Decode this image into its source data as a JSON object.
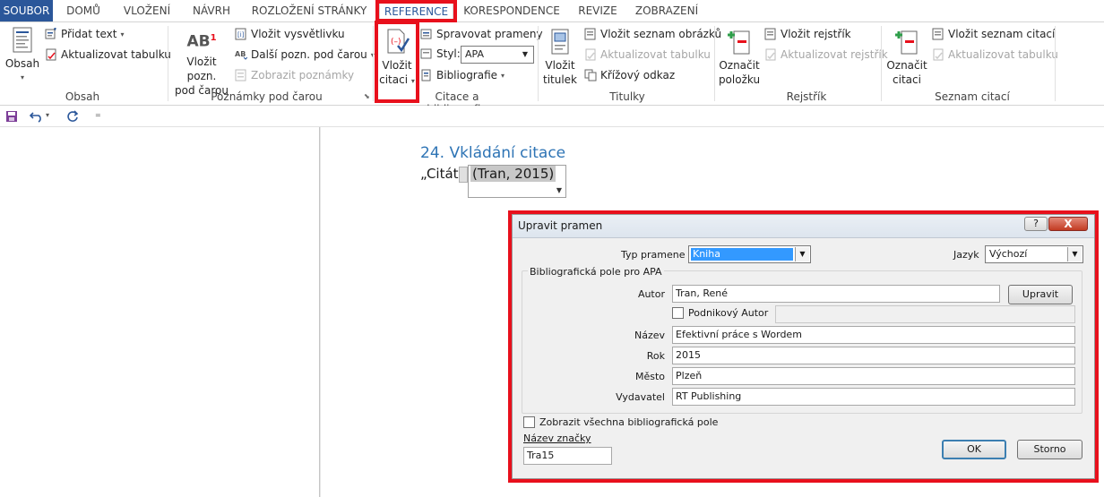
{
  "tabs": [
    {
      "label": "SOUBOR",
      "kind": "file"
    },
    {
      "label": "DOMŮ"
    },
    {
      "label": "VLOŽENÍ"
    },
    {
      "label": "NÁVRH"
    },
    {
      "label": "ROZLOŽENÍ STRÁNKY"
    },
    {
      "label": "REFERENCE",
      "kind": "active"
    },
    {
      "label": "KORESPONDENCE"
    },
    {
      "label": "REVIZE"
    },
    {
      "label": "ZOBRAZENÍ"
    }
  ],
  "ribbon": {
    "obsah": {
      "group_label": "Obsah",
      "big_label": "Obsah",
      "pridat_text": "Přidat text",
      "aktualizovat_tabulku": "Aktualizovat tabulku"
    },
    "poznamky": {
      "group_label": "Poznámky pod čarou",
      "big_label_1": "Vložit pozn.",
      "big_label_2": "pod čarou",
      "big_icon_text": "AB",
      "big_icon_sup": "1",
      "vlozit_vysvetlivku": "Vložit vysvětlivku",
      "dalsi_pozn": "Další pozn. pod čarou",
      "zobrazit_poznamky": "Zobrazit poznámky"
    },
    "citace": {
      "group_label": "Citace a bibliografie",
      "big_label_1": "Vložit",
      "big_label_2": "citaci",
      "spravovat_prameny": "Spravovat prameny",
      "styl_label": "Styl:",
      "styl_value": "APA",
      "bibliografie": "Bibliografie"
    },
    "titulky": {
      "group_label": "Titulky",
      "big_label_1": "Vložit",
      "big_label_2": "titulek",
      "vlozit_seznam_obrazku": "Vložit seznam obrázků",
      "aktualizovat_tabulku": "Aktualizovat tabulku",
      "krizovy_odkaz": "Křížový odkaz"
    },
    "rejstrik": {
      "group_label": "Rejstřík",
      "big_label_1": "Označit",
      "big_label_2": "položku",
      "vlozit_rejstrik": "Vložit rejstřík",
      "aktualizovat_rejstrik": "Aktualizovat rejstřík"
    },
    "seznam_citaci": {
      "group_label": "Seznam citací",
      "big_label_1": "Označit",
      "big_label_2": "citaci",
      "vlozit_seznam_citaci": "Vložit seznam citací",
      "aktualizovat_tabulku": "Aktualizovat tabulku"
    }
  },
  "document": {
    "heading": "24. Vkládání citace",
    "quote_prefix": "„Citát.",
    "citation": "(Tran, 2015)",
    "quote_suffix": "."
  },
  "dialog": {
    "title": "Upravit pramen",
    "help": "?",
    "close": "X",
    "typ_pramene_label": "Typ pramene",
    "typ_pramene_value": "Kniha",
    "jazyk_label": "Jazyk",
    "jazyk_value": "Výchozí",
    "fieldset_legend": "Bibliografická pole pro APA",
    "autor_label": "Autor",
    "autor_value": "Tran, René",
    "upravit_button": "Upravit",
    "podnikovy_autor_label": "Podnikový Autor",
    "nazev_label": "Název",
    "nazev_value": "Efektivní práce s Wordem",
    "rok_label": "Rok",
    "rok_value": "2015",
    "mesto_label": "Město",
    "mesto_value": "Plzeň",
    "vydavatel_label": "Vydavatel",
    "vydavatel_value": "RT Publishing",
    "zobrazit_vsechna_label": "Zobrazit všechna bibliografická pole",
    "nazev_znacky_label": "Název značky",
    "nazev_znacky_value": "Tra15",
    "ok_button": "OK",
    "storno_button": "Storno"
  },
  "colors": {
    "accent": "#2b579a",
    "highlight": "#e8101c",
    "heading": "#2e74b5"
  }
}
